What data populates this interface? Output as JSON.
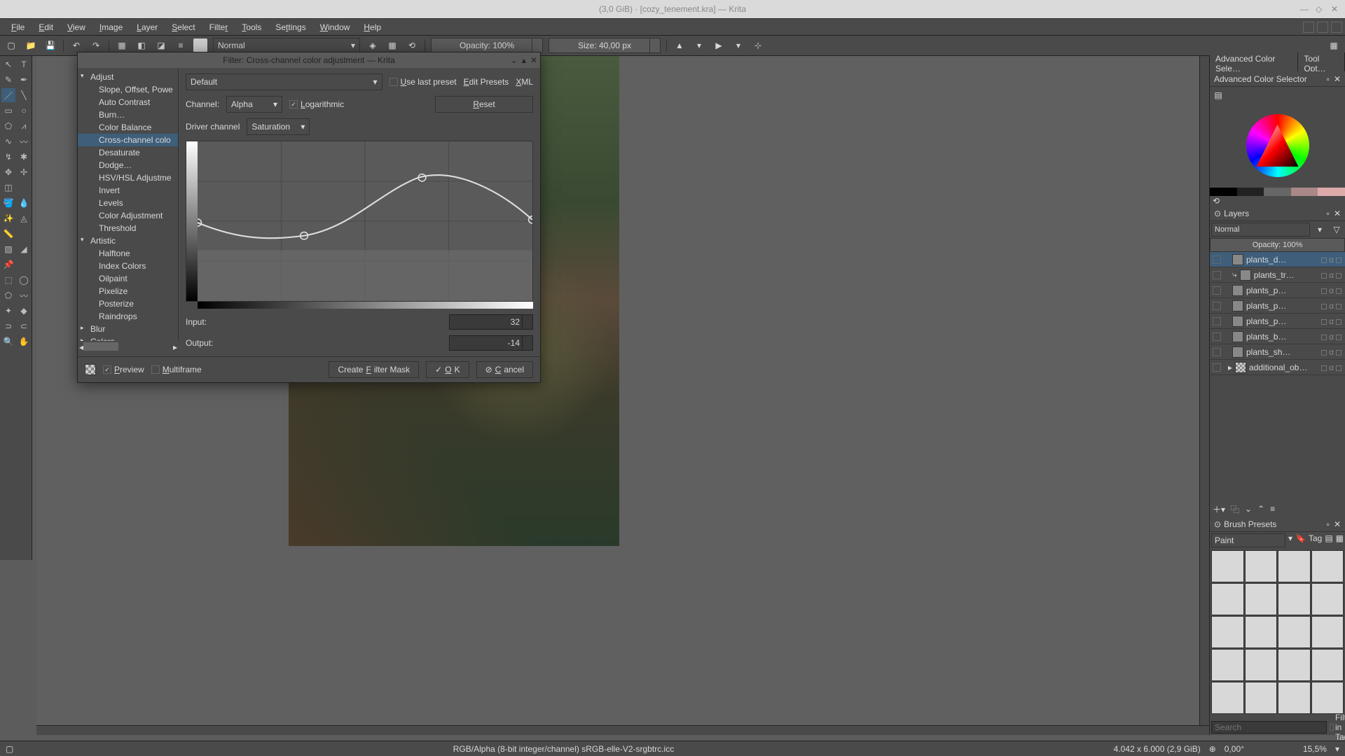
{
  "window": {
    "title": "(3,0 GiB) · [cozy_tenement.kra] — Krita"
  },
  "menus": [
    "File",
    "Edit",
    "View",
    "Image",
    "Layer",
    "Select",
    "Filter",
    "Tools",
    "Settings",
    "Window",
    "Help"
  ],
  "options": {
    "blend_mode": "Normal",
    "opacity": "Opacity: 100%",
    "size": "Size: 40,00 px"
  },
  "right_tabs": {
    "color": "Advanced Color Sele…",
    "toolopt": "Tool Opt…",
    "color_header": "Advanced Color Selector"
  },
  "layers": {
    "header": "Layers",
    "blend": "Normal",
    "opacity": "Opacity:  100%",
    "items": [
      {
        "name": "plants_d…",
        "selected": true
      },
      {
        "name": "plants_tr…"
      },
      {
        "name": "plants_p…"
      },
      {
        "name": "plants_p…"
      },
      {
        "name": "plants_p…"
      },
      {
        "name": "plants_b…"
      },
      {
        "name": "plants_sh…"
      },
      {
        "name": "additional_ob…"
      }
    ]
  },
  "brushes": {
    "header": "Brush Presets",
    "category": "Paint",
    "tag_label": "Tag",
    "search_placeholder": "Search",
    "filter_label": "Filter in Tag"
  },
  "status": {
    "colorspace": "RGB/Alpha (8-bit integer/channel)  sRGB-elle-V2-srgbtrc.icc",
    "dims": "4.042 x 6.000 (2,9 GiB)",
    "angle": "0,00°",
    "zoom": "15,5%"
  },
  "dialog": {
    "title": "Filter: Cross-channel color adjustment — Krita",
    "tree": {
      "adjust": "Adjust",
      "adjust_items": [
        "Slope, Offset, Powe",
        "Auto Contrast",
        "Burn…",
        "Color Balance",
        "Cross-channel colo",
        "Desaturate",
        "Dodge…",
        "HSV/HSL Adjustme",
        "Invert",
        "Levels",
        "Color Adjustment",
        "Threshold"
      ],
      "artistic": "Artistic",
      "artistic_items": [
        "Halftone",
        "Index Colors",
        "Oilpaint",
        "Pixelize",
        "Posterize",
        "Raindrops"
      ],
      "blur": "Blur",
      "colors": "Colors"
    },
    "preset": "Default",
    "use_last": "Use last preset",
    "edit_presets": "Edit Presets",
    "xml": "XML",
    "channel_label": "Channel:",
    "channel": "Alpha",
    "log": "Logarithmic",
    "reset": "Reset",
    "driver_label": "Driver channel",
    "driver": "Saturation",
    "input_label": "Input:",
    "input": "32",
    "output_label": "Output:",
    "output": "-14",
    "preview": "Preview",
    "multiframe": "Multiframe",
    "create_mask": "Create Filter Mask",
    "ok": "OK",
    "cancel": "Cancel"
  }
}
